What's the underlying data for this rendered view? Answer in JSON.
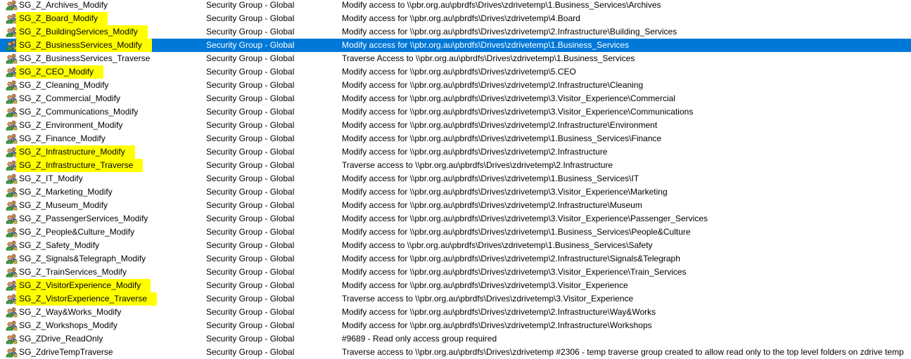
{
  "colors": {
    "selection": "#0078d7",
    "highlight": "#ffff00"
  },
  "icon": "security-group-icon",
  "rows": [
    {
      "name": "SG_Z_Archives_Modify",
      "type": "Security Group - Global",
      "description": "Modify access to \\\\pbr.org.au\\pbrdfs\\Drives\\zdrivetemp\\1.Business_Services\\Archives",
      "highlighted": false,
      "selected": false
    },
    {
      "name": "SG_Z_Board_Modify",
      "type": "Security Group - Global",
      "description": "Modify access for \\\\pbr.org.au\\pbrdfs\\Drives\\zdrivetemp\\4.Board",
      "highlighted": true,
      "selected": false
    },
    {
      "name": "SG_Z_BuildingServices_Modify",
      "type": "Security Group - Global",
      "description": "Modify access for \\\\pbr.org.au\\pbrdfs\\Drives\\zdrivetemp\\2.Infrastructure\\Building_Services",
      "highlighted": true,
      "selected": false
    },
    {
      "name": "SG_Z_BusinessServices_Modify",
      "type": "Security Group - Global",
      "description": "Modify access for \\\\pbr.org.au\\pbrdfs\\Drives\\zdrivetemp\\1.Business_Services",
      "highlighted": true,
      "selected": true
    },
    {
      "name": "SG_Z_BusinessServices_Traverse",
      "type": "Security Group - Global",
      "description": "Traverse Access to \\\\pbr.org.au\\pbrdfs\\Drives\\zdrivetemp\\1.Business_Services",
      "highlighted": false,
      "selected": false
    },
    {
      "name": "SG_Z_CEO_Modify",
      "type": "Security Group - Global",
      "description": "Modify access for \\\\pbr.org.au\\pbrdfs\\Drives\\zdrivetemp\\5.CEO",
      "highlighted": true,
      "selected": false
    },
    {
      "name": "SG_Z_Cleaning_Modify",
      "type": "Security Group - Global",
      "description": "Modify access for \\\\pbr.org.au\\pbrdfs\\Drives\\zdrivetemp\\2.Infrastructure\\Cleaning",
      "highlighted": false,
      "selected": false
    },
    {
      "name": "SG_Z_Commercial_Modify",
      "type": "Security Group - Global",
      "description": "Modify access for \\\\pbr.org.au\\pbrdfs\\Drives\\zdrivetemp\\3.Visitor_Experience\\Commercial",
      "highlighted": false,
      "selected": false
    },
    {
      "name": "SG_Z_Communications_Modify",
      "type": "Security Group - Global",
      "description": "Modify access for \\\\pbr.org.au\\pbrdfs\\Drives\\zdrivetemp\\3.Visitor_Experience\\Communications",
      "highlighted": false,
      "selected": false
    },
    {
      "name": "SG_Z_Environment_Modify",
      "type": "Security Group - Global",
      "description": "Modify access for \\\\pbr.org.au\\pbrdfs\\Drives\\zdrivetemp\\2.Infrastructure\\Environment",
      "highlighted": false,
      "selected": false
    },
    {
      "name": "SG_Z_Finance_Modify",
      "type": "Security Group - Global",
      "description": "Modify access for \\\\pbr.org.au\\pbrdfs\\Drives\\zdrivetemp\\1.Business_Services\\Finance",
      "highlighted": false,
      "selected": false
    },
    {
      "name": "SG_Z_Infrastructure_Modify",
      "type": "Security Group - Global",
      "description": "Modify access for \\\\pbr.org.au\\pbrdfs\\Drives\\zdrivetemp\\2.Infrastructure",
      "highlighted": true,
      "selected": false
    },
    {
      "name": "SG_Z_Infrastructure_Traverse",
      "type": "Security Group - Global",
      "description": "Traverse access to \\\\pbr.org.au\\pbrdfs\\Drives\\zdrivetemp\\2.Infrastructure",
      "highlighted": true,
      "selected": false
    },
    {
      "name": "SG_Z_IT_Modify",
      "type": "Security Group - Global",
      "description": "Modify access for \\\\pbr.org.au\\pbrdfs\\Drives\\zdrivetemp\\1.Business_Services\\IT",
      "highlighted": false,
      "selected": false
    },
    {
      "name": "SG_Z_Marketing_Modify",
      "type": "Security Group - Global",
      "description": "Modify access for \\\\pbr.org.au\\pbrdfs\\Drives\\zdrivetemp\\3.Visitor_Experience\\Marketing",
      "highlighted": false,
      "selected": false
    },
    {
      "name": "SG_Z_Museum_Modify",
      "type": "Security Group - Global",
      "description": "Modify access for \\\\pbr.org.au\\pbrdfs\\Drives\\zdrivetemp\\2.Infrastructure\\Museum",
      "highlighted": false,
      "selected": false
    },
    {
      "name": "SG_Z_PassengerServices_Modify",
      "type": "Security Group - Global",
      "description": "Modify access for \\\\pbr.org.au\\pbrdfs\\Drives\\zdrivetemp\\3.Visitor_Experience\\Passenger_Services",
      "highlighted": false,
      "selected": false
    },
    {
      "name": "SG_Z_People&Culture_Modify",
      "type": "Security Group - Global",
      "description": "Modify access for \\\\pbr.org.au\\pbrdfs\\Drives\\zdrivetemp\\1.Business_Services\\People&Culture",
      "highlighted": false,
      "selected": false
    },
    {
      "name": "SG_Z_Safety_Modify",
      "type": "Security Group - Global",
      "description": "Modify access to \\\\pbr.org.au\\pbrdfs\\Drives\\zdrivetemp\\1.Business_Services\\Safety",
      "highlighted": false,
      "selected": false
    },
    {
      "name": "SG_Z_Signals&Telegraph_Modify",
      "type": "Security Group - Global",
      "description": "Modify access for \\\\pbr.org.au\\pbrdfs\\Drives\\zdrivetemp\\2.Infrastructure\\Signals&Telegraph",
      "highlighted": false,
      "selected": false
    },
    {
      "name": "SG_Z_TrainServices_Modify",
      "type": "Security Group - Global",
      "description": "Modify access for \\\\pbr.org.au\\pbrdfs\\Drives\\zdrivetemp\\3.Visitor_Experience\\Train_Services",
      "highlighted": false,
      "selected": false
    },
    {
      "name": "SG_Z_VisitorExperience_Modify",
      "type": "Security Group - Global",
      "description": "Modify access for \\\\pbr.org.au\\pbrdfs\\Drives\\zdrivetemp\\3.Visitor_Experience",
      "highlighted": true,
      "selected": false
    },
    {
      "name": "SG_Z_VistorExperience_Traverse",
      "type": "Security Group - Global",
      "description": "Traverse access to \\\\pbr.org.au\\pbrdfs\\Drives\\zdrivetemp\\3.Visitor_Experience",
      "highlighted": true,
      "selected": false
    },
    {
      "name": "SG_Z_Way&Works_Modify",
      "type": "Security Group - Global",
      "description": "Modify access for \\\\pbr.org.au\\pbrdfs\\Drives\\zdrivetemp\\2.Infrastructure\\Way&Works",
      "highlighted": false,
      "selected": false
    },
    {
      "name": "SG_Z_Workshops_Modify",
      "type": "Security Group - Global",
      "description": "Modify access for \\\\pbr.org.au\\pbrdfs\\Drives\\zdrivetemp\\2.Infrastructure\\Workshops",
      "highlighted": false,
      "selected": false
    },
    {
      "name": "SG_ZDrive_ReadOnly",
      "type": "Security Group - Global",
      "description": "#9689 - Read only access group required",
      "highlighted": false,
      "selected": false
    },
    {
      "name": "SG_ZdriveTempTraverse",
      "type": "Security Group - Global",
      "description": "Traverse access to \\\\pbr.org.au\\pbrdfs\\Drives\\zdrivetemp #2306 - temp traverse group created to allow read only to the top level folders on zdrive temp",
      "highlighted": false,
      "selected": false
    }
  ]
}
